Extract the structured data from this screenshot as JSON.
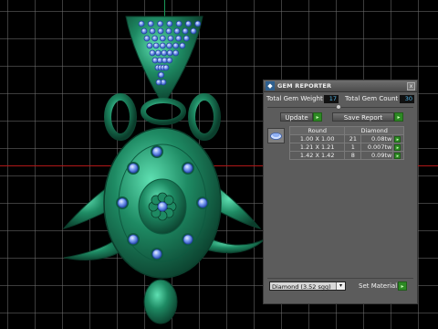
{
  "panel": {
    "title": "GEM REPORTER",
    "close_label": "x",
    "total_gem_weight_label": "Total Gem Weight",
    "total_gem_weight_value": "17",
    "total_gem_count_label": "Total Gem Count",
    "total_gem_count_value": "30",
    "update_label": "Update",
    "save_report_label": "Save Report",
    "go_glyph": "▸"
  },
  "table": {
    "headers": [
      "Round",
      "Diamond"
    ],
    "rows": [
      {
        "size": "1.00 X 1.00",
        "count": "21",
        "weight": "0.08tw"
      },
      {
        "size": "1.21 X 1.21",
        "count": "1",
        "weight": "0.007tw"
      },
      {
        "size": "1.42 X 1.42",
        "count": "8",
        "weight": "0.09tw"
      }
    ]
  },
  "footer": {
    "material_value": "Diamond   (3.52 sgg)",
    "caret": "▾",
    "set_material_label": "Set Material"
  },
  "colors": {
    "metal": "#1e8a63",
    "gem": "#5a7fe0",
    "grid": "#6e6e6e",
    "panel": "#5c5c5c",
    "accent_green": "#2d8a24"
  }
}
